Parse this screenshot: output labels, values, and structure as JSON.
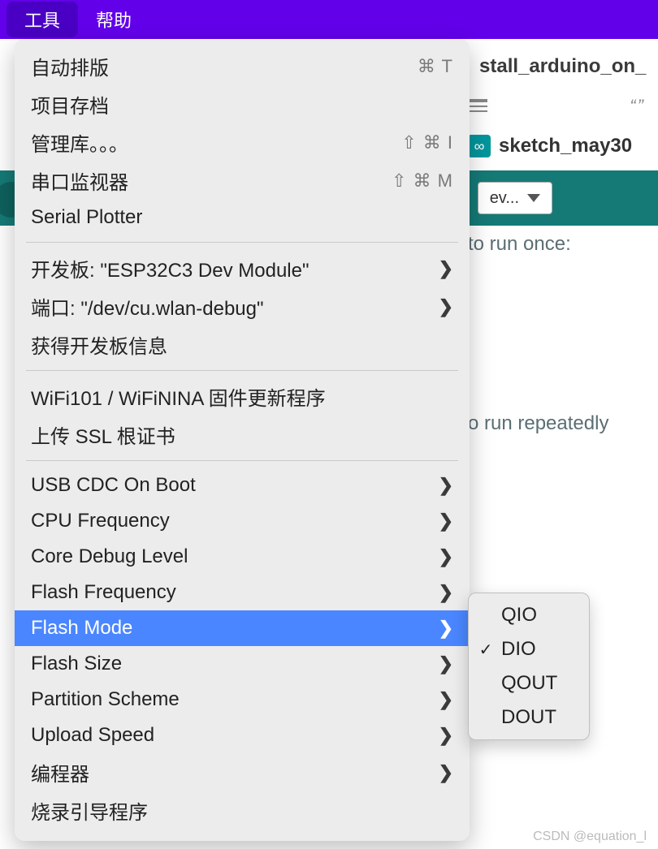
{
  "menubar": {
    "tools": "工具",
    "help": "帮助"
  },
  "tab": {
    "filename": "stall_arduino_on_"
  },
  "ide": {
    "sketch_name": "sketch_may30",
    "board_dropdown": "ev...",
    "arduino_glyph": "∞"
  },
  "code": {
    "line1": "to run once:",
    "line2": "o run repeatedly"
  },
  "tools_menu": {
    "auto_format": "自动排版",
    "auto_format_shortcut": "⌘ T",
    "archive": "项目存档",
    "manage_libs": "管理库。。。",
    "manage_libs_shortcut": "⇧ ⌘ I",
    "serial_monitor": "串口监视器",
    "serial_monitor_shortcut": "⇧ ⌘ M",
    "serial_plotter": "Serial Plotter",
    "board": "开发板: \"ESP32C3 Dev Module\"",
    "port": "端口: \"/dev/cu.wlan-debug\"",
    "board_info": "获得开发板信息",
    "wifi_fw": "WiFi101 / WiFiNINA 固件更新程序",
    "ssl_cert": "上传 SSL 根证书",
    "usb_cdc": "USB CDC On Boot",
    "cpu_freq": "CPU Frequency",
    "core_debug": "Core Debug Level",
    "flash_freq": "Flash Frequency",
    "flash_mode": "Flash Mode",
    "flash_size": "Flash Size",
    "partition": "Partition Scheme",
    "upload_speed": "Upload Speed",
    "programmer": "编程器",
    "burn_bootloader": "烧录引导程序"
  },
  "flash_mode_submenu": {
    "o0": "QIO",
    "o1": "DIO",
    "o2": "QOUT",
    "o3": "DOUT",
    "selected_index": 1
  },
  "watermark": "CSDN @equation_l",
  "glyph": {
    "chevron": "❯",
    "check": "✓",
    "quotes": "“ ”"
  }
}
